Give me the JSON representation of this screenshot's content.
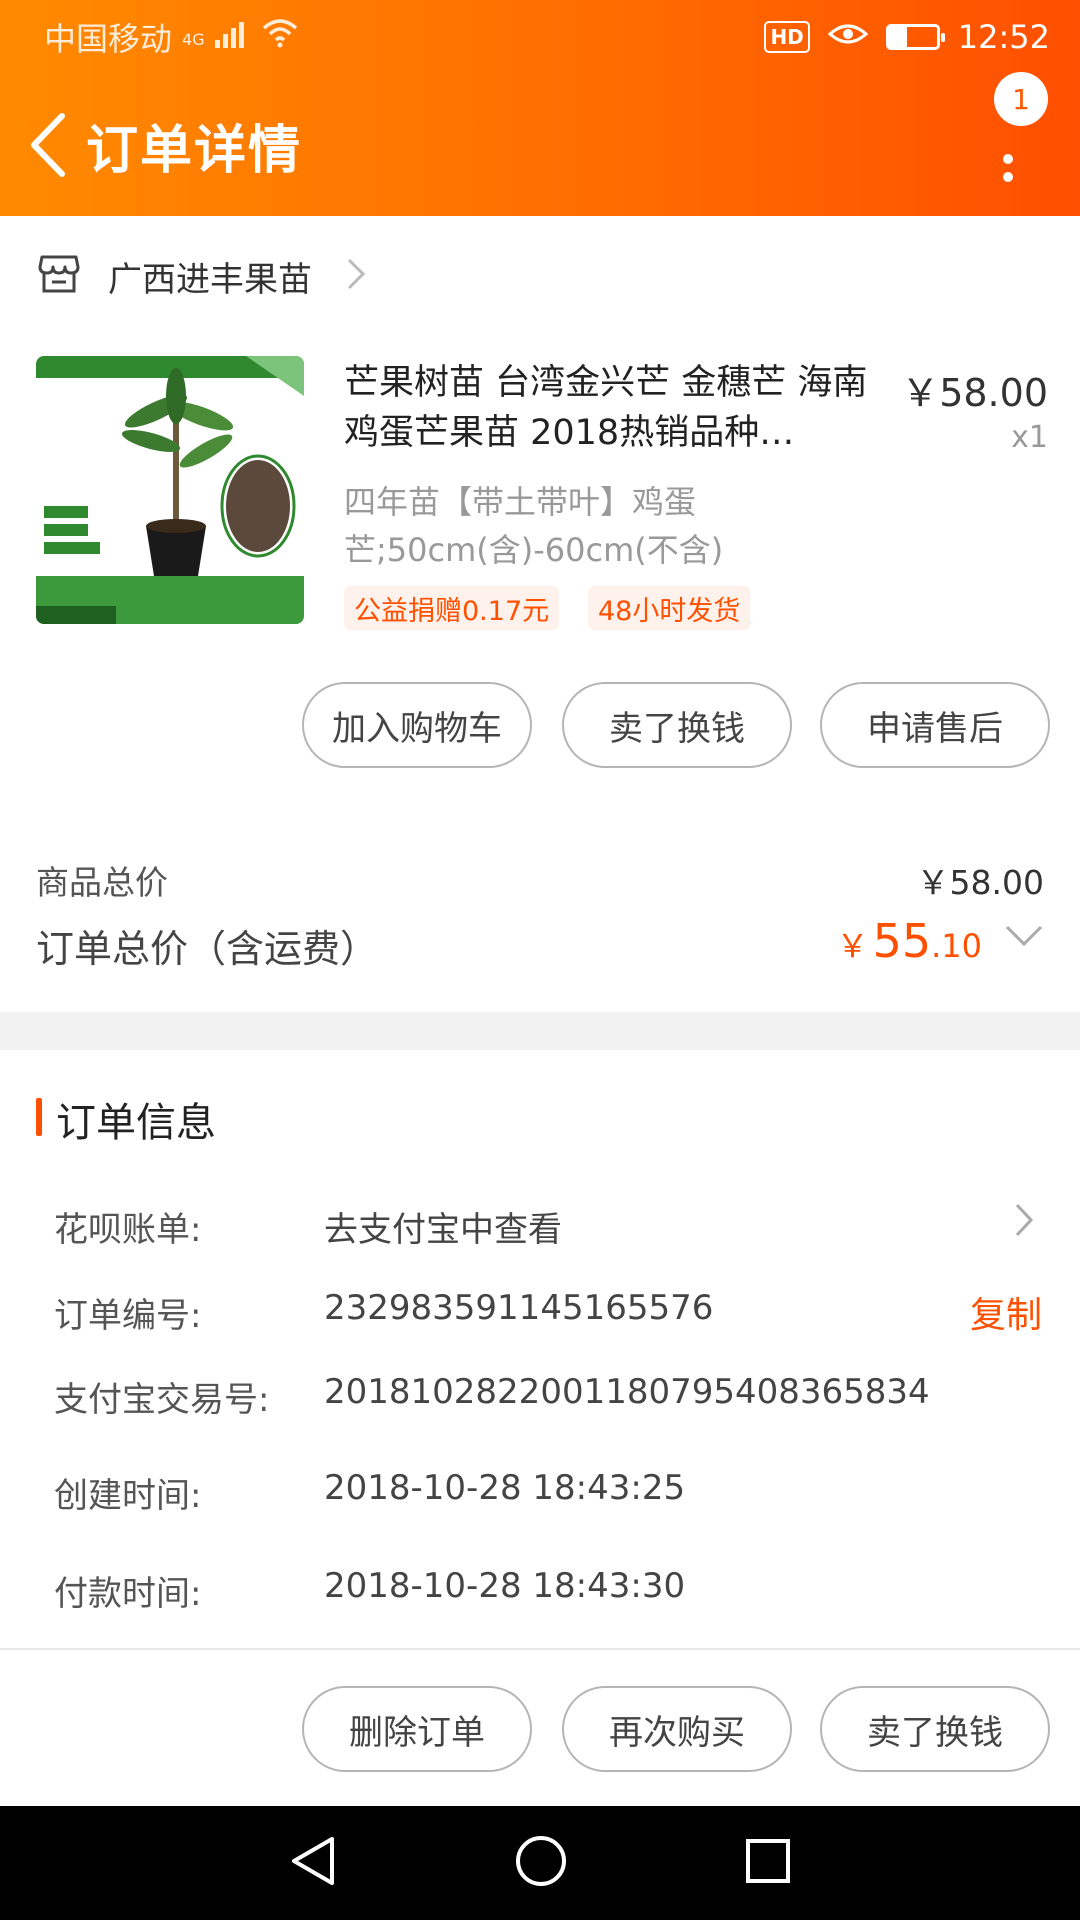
{
  "status_bar": {
    "carrier": "中国移动",
    "network": "4G",
    "hd": "HD",
    "time": "12:52"
  },
  "nav": {
    "title": "订单详情",
    "message_count": "1"
  },
  "store": {
    "name": "广西进丰果苗"
  },
  "product": {
    "title": "芒果树苗 台湾金兴芒 金穗芒 海南鸡蛋芒果苗 2018热销品种…",
    "price": "￥58.00",
    "quantity": "x1",
    "sku": "四年苗【带土带叶】鸡蛋芒;50cm(含)-60cm(不含)",
    "tags": [
      "公益捐赠0.17元",
      "48小时发货"
    ]
  },
  "item_actions": [
    "加入购物车",
    "卖了换钱",
    "申请售后"
  ],
  "summary": {
    "goods_total_label": "商品总价",
    "goods_total_value": "￥58.00",
    "order_total_label": "订单总价（含运费）",
    "order_total_currency": "￥",
    "order_total_int": "55",
    "order_total_dec": ".10"
  },
  "order_info": {
    "title": "订单信息",
    "rows": [
      {
        "label": "花呗账单:",
        "value": "去支付宝中查看"
      },
      {
        "label": "订单编号:",
        "value": "232983591145165576"
      },
      {
        "label": "支付宝交易号:",
        "value": "2018102822001180795408365834"
      },
      {
        "label": "创建时间:",
        "value": "2018-10-28 18:43:25"
      },
      {
        "label": "付款时间:",
        "value": "2018-10-28 18:43:30"
      }
    ],
    "copy_label": "复制"
  },
  "bottom_actions": [
    "删除订单",
    "再次购买",
    "卖了换钱"
  ],
  "colors": {
    "accent": "#ff5000",
    "header_start": "#ff8a00",
    "header_end": "#ff4f00"
  }
}
